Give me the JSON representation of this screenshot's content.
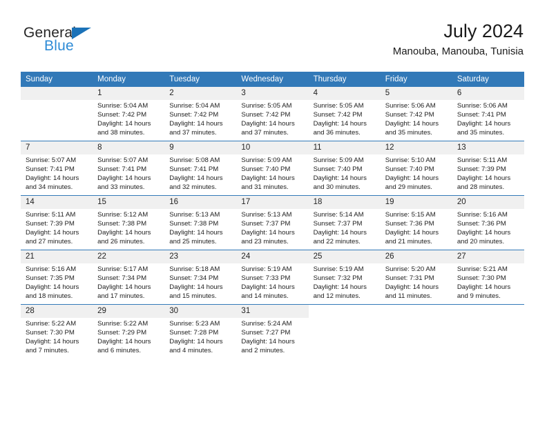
{
  "brand": {
    "name_top": "General",
    "name_bottom": "Blue",
    "triangle_color": "#1b72b8",
    "blue_text_color": "#2e8bd6"
  },
  "header": {
    "title": "July 2024",
    "subtitle": "Manouba, Manouba, Tunisia"
  },
  "theme": {
    "header_blue": "#3279b8",
    "daynum_band": "#f0f0f0",
    "row_divider": "#3279b8"
  },
  "weekdays": [
    "Sunday",
    "Monday",
    "Tuesday",
    "Wednesday",
    "Thursday",
    "Friday",
    "Saturday"
  ],
  "weeks": [
    [
      {
        "day": "",
        "sunrise": "",
        "sunset": "",
        "daylight": "",
        "empty": true
      },
      {
        "day": "1",
        "sunrise": "Sunrise: 5:04 AM",
        "sunset": "Sunset: 7:42 PM",
        "daylight": "Daylight: 14 hours and 38 minutes."
      },
      {
        "day": "2",
        "sunrise": "Sunrise: 5:04 AM",
        "sunset": "Sunset: 7:42 PM",
        "daylight": "Daylight: 14 hours and 37 minutes."
      },
      {
        "day": "3",
        "sunrise": "Sunrise: 5:05 AM",
        "sunset": "Sunset: 7:42 PM",
        "daylight": "Daylight: 14 hours and 37 minutes."
      },
      {
        "day": "4",
        "sunrise": "Sunrise: 5:05 AM",
        "sunset": "Sunset: 7:42 PM",
        "daylight": "Daylight: 14 hours and 36 minutes."
      },
      {
        "day": "5",
        "sunrise": "Sunrise: 5:06 AM",
        "sunset": "Sunset: 7:42 PM",
        "daylight": "Daylight: 14 hours and 35 minutes."
      },
      {
        "day": "6",
        "sunrise": "Sunrise: 5:06 AM",
        "sunset": "Sunset: 7:41 PM",
        "daylight": "Daylight: 14 hours and 35 minutes."
      }
    ],
    [
      {
        "day": "7",
        "sunrise": "Sunrise: 5:07 AM",
        "sunset": "Sunset: 7:41 PM",
        "daylight": "Daylight: 14 hours and 34 minutes."
      },
      {
        "day": "8",
        "sunrise": "Sunrise: 5:07 AM",
        "sunset": "Sunset: 7:41 PM",
        "daylight": "Daylight: 14 hours and 33 minutes."
      },
      {
        "day": "9",
        "sunrise": "Sunrise: 5:08 AM",
        "sunset": "Sunset: 7:41 PM",
        "daylight": "Daylight: 14 hours and 32 minutes."
      },
      {
        "day": "10",
        "sunrise": "Sunrise: 5:09 AM",
        "sunset": "Sunset: 7:40 PM",
        "daylight": "Daylight: 14 hours and 31 minutes."
      },
      {
        "day": "11",
        "sunrise": "Sunrise: 5:09 AM",
        "sunset": "Sunset: 7:40 PM",
        "daylight": "Daylight: 14 hours and 30 minutes."
      },
      {
        "day": "12",
        "sunrise": "Sunrise: 5:10 AM",
        "sunset": "Sunset: 7:40 PM",
        "daylight": "Daylight: 14 hours and 29 minutes."
      },
      {
        "day": "13",
        "sunrise": "Sunrise: 5:11 AM",
        "sunset": "Sunset: 7:39 PM",
        "daylight": "Daylight: 14 hours and 28 minutes."
      }
    ],
    [
      {
        "day": "14",
        "sunrise": "Sunrise: 5:11 AM",
        "sunset": "Sunset: 7:39 PM",
        "daylight": "Daylight: 14 hours and 27 minutes."
      },
      {
        "day": "15",
        "sunrise": "Sunrise: 5:12 AM",
        "sunset": "Sunset: 7:38 PM",
        "daylight": "Daylight: 14 hours and 26 minutes."
      },
      {
        "day": "16",
        "sunrise": "Sunrise: 5:13 AM",
        "sunset": "Sunset: 7:38 PM",
        "daylight": "Daylight: 14 hours and 25 minutes."
      },
      {
        "day": "17",
        "sunrise": "Sunrise: 5:13 AM",
        "sunset": "Sunset: 7:37 PM",
        "daylight": "Daylight: 14 hours and 23 minutes."
      },
      {
        "day": "18",
        "sunrise": "Sunrise: 5:14 AM",
        "sunset": "Sunset: 7:37 PM",
        "daylight": "Daylight: 14 hours and 22 minutes."
      },
      {
        "day": "19",
        "sunrise": "Sunrise: 5:15 AM",
        "sunset": "Sunset: 7:36 PM",
        "daylight": "Daylight: 14 hours and 21 minutes."
      },
      {
        "day": "20",
        "sunrise": "Sunrise: 5:16 AM",
        "sunset": "Sunset: 7:36 PM",
        "daylight": "Daylight: 14 hours and 20 minutes."
      }
    ],
    [
      {
        "day": "21",
        "sunrise": "Sunrise: 5:16 AM",
        "sunset": "Sunset: 7:35 PM",
        "daylight": "Daylight: 14 hours and 18 minutes."
      },
      {
        "day": "22",
        "sunrise": "Sunrise: 5:17 AM",
        "sunset": "Sunset: 7:34 PM",
        "daylight": "Daylight: 14 hours and 17 minutes."
      },
      {
        "day": "23",
        "sunrise": "Sunrise: 5:18 AM",
        "sunset": "Sunset: 7:34 PM",
        "daylight": "Daylight: 14 hours and 15 minutes."
      },
      {
        "day": "24",
        "sunrise": "Sunrise: 5:19 AM",
        "sunset": "Sunset: 7:33 PM",
        "daylight": "Daylight: 14 hours and 14 minutes."
      },
      {
        "day": "25",
        "sunrise": "Sunrise: 5:19 AM",
        "sunset": "Sunset: 7:32 PM",
        "daylight": "Daylight: 14 hours and 12 minutes."
      },
      {
        "day": "26",
        "sunrise": "Sunrise: 5:20 AM",
        "sunset": "Sunset: 7:31 PM",
        "daylight": "Daylight: 14 hours and 11 minutes."
      },
      {
        "day": "27",
        "sunrise": "Sunrise: 5:21 AM",
        "sunset": "Sunset: 7:30 PM",
        "daylight": "Daylight: 14 hours and 9 minutes."
      }
    ],
    [
      {
        "day": "28",
        "sunrise": "Sunrise: 5:22 AM",
        "sunset": "Sunset: 7:30 PM",
        "daylight": "Daylight: 14 hours and 7 minutes."
      },
      {
        "day": "29",
        "sunrise": "Sunrise: 5:22 AM",
        "sunset": "Sunset: 7:29 PM",
        "daylight": "Daylight: 14 hours and 6 minutes."
      },
      {
        "day": "30",
        "sunrise": "Sunrise: 5:23 AM",
        "sunset": "Sunset: 7:28 PM",
        "daylight": "Daylight: 14 hours and 4 minutes."
      },
      {
        "day": "31",
        "sunrise": "Sunrise: 5:24 AM",
        "sunset": "Sunset: 7:27 PM",
        "daylight": "Daylight: 14 hours and 2 minutes."
      },
      {
        "day": "",
        "sunrise": "",
        "sunset": "",
        "daylight": "",
        "blank": true
      },
      {
        "day": "",
        "sunrise": "",
        "sunset": "",
        "daylight": "",
        "blank": true
      },
      {
        "day": "",
        "sunrise": "",
        "sunset": "",
        "daylight": "",
        "blank": true
      }
    ]
  ]
}
